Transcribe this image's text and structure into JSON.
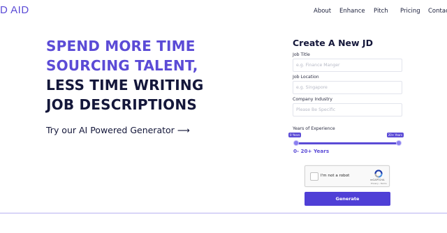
{
  "brand": {
    "logo_text": "D AID",
    "accent": "#5b4bd6",
    "dark": "#14173a"
  },
  "nav": {
    "items": [
      "About",
      "Enhance",
      "Pitch",
      "Pricing",
      "Contac"
    ]
  },
  "hero": {
    "line1": "SPEND MORE TIME",
    "line2": "SOURCING TALENT,",
    "line3": "LESS TIME WRITING",
    "line4": "JOB DESCRIPTIONS",
    "tagline": "Try our AI Powered Generator ⟶"
  },
  "form": {
    "title": "Create A New JD",
    "job_title": {
      "label": "Job Title",
      "placeholder": "e.g. Finance Manger",
      "value": ""
    },
    "job_location": {
      "label": "Job Location",
      "placeholder": "e.g. Singapore",
      "value": ""
    },
    "company_industry": {
      "label": "Company Industry",
      "placeholder": "Please Be Specific",
      "value": ""
    },
    "experience": {
      "label": "Years of Experience",
      "min_tag": "0 Years",
      "max_tag": "20+ Years",
      "value_text": "0- 20+ Years",
      "range_min": 0,
      "range_max": 20,
      "low": 0,
      "high": 20
    },
    "captcha": {
      "checkbox_label": "I'm not a robot",
      "brand": "reCAPTCHA",
      "terms": "Privacy - Terms"
    },
    "generate_label": "Generate"
  }
}
